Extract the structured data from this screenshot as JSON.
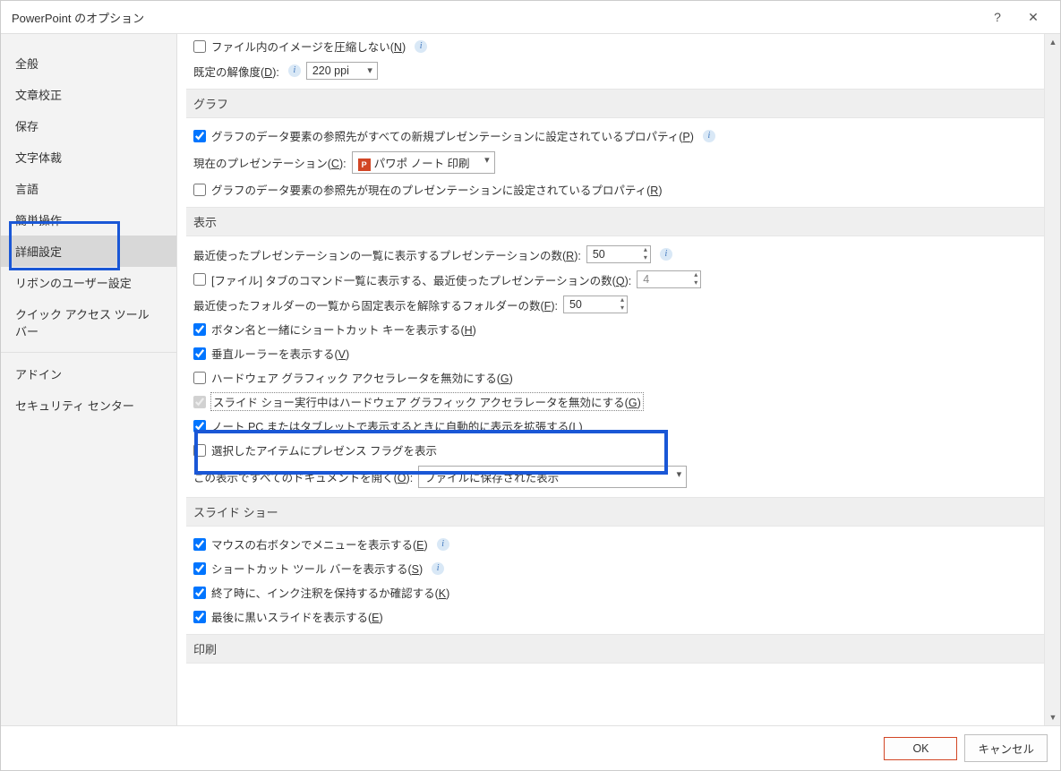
{
  "title": "PowerPoint のオプション",
  "sidebar": {
    "items": [
      {
        "label": "全般"
      },
      {
        "label": "文章校正"
      },
      {
        "label": "保存"
      },
      {
        "label": "文字体裁"
      },
      {
        "label": "言語"
      },
      {
        "label": "簡単操作"
      },
      {
        "label": "詳細設定",
        "selected": true
      },
      {
        "label": "リボンのユーザー設定"
      },
      {
        "label": "クイック アクセス ツール バー"
      },
      {
        "label": "アドイン"
      },
      {
        "label": "セキュリティ センター"
      }
    ]
  },
  "content": {
    "image_group": {
      "chk1_label": "ファイル内のイメージを圧縮しない(",
      "chk1_key": "N",
      "res_label_pre": "既定の解像度(",
      "res_key": "D",
      "res_label_post": "):",
      "res_value": "220 ppi"
    },
    "graph": {
      "title": "グラフ",
      "chk1_label": "グラフのデータ要素の参照先がすべての新規プレゼンテーションに設定されているプロパティ(",
      "chk1_key": "P",
      "pres_label_pre": "現在のプレゼンテーション(",
      "pres_key": "C",
      "pres_label_post": "):",
      "pres_value": "パワポ ノート 印刷",
      "chk2_label": "グラフのデータ要素の参照先が現在のプレゼンテーションに設定されているプロパティ(",
      "chk2_key": "R"
    },
    "display": {
      "title": "表示",
      "recent_pres_label_pre": "最近使ったプレゼンテーションの一覧に表示するプレゼンテーションの数(",
      "recent_pres_key": "R",
      "recent_pres_label_post": "):",
      "recent_pres_value": "50",
      "quick_label_pre": "[ファイル] タブのコマンド一覧に表示する、最近使ったプレゼンテーションの数(",
      "quick_key": "Q",
      "quick_label_post": "):",
      "quick_value": "4",
      "folders_label_pre": "最近使ったフォルダーの一覧から固定表示を解除するフォルダーの数(",
      "folders_key": "F",
      "folders_label_post": "):",
      "folders_value": "50",
      "chk_shortcut_label": "ボタン名と一緒にショートカット キーを表示する(",
      "chk_shortcut_key": "H",
      "chk_ruler_label": "垂直ルーラーを表示する(",
      "chk_ruler_key": "V",
      "chk_hwaccel_label": "ハードウェア グラフィック アクセラレータを無効にする(",
      "chk_hwaccel_key": "G",
      "chk_slideshow_hw_label": "スライド ショー実行中はハードウェア グラフィック アクセラレータを無効にする(",
      "chk_slideshow_hw_key": "G",
      "chk_laptop_label": "ノート PC またはタブレットで表示するときに自動的に表示を拡張する(",
      "chk_laptop_key": "L",
      "chk_presence_label": "選択したアイテムにプレゼンス フラグを表示",
      "open_docs_label_pre": "この表示ですべてのドキュメントを開く(",
      "open_docs_key": "O",
      "open_docs_label_post": "):",
      "open_docs_value": "ファイルに保存された表示"
    },
    "slideshow": {
      "title": "スライド ショー",
      "chk_rclick_label": "マウスの右ボタンでメニューを表示する(",
      "chk_rclick_key": "E",
      "chk_toolbar_label": "ショートカット ツール バーを表示する(",
      "chk_toolbar_key": "S",
      "chk_ink_label": "終了時に、インク注釈を保持するか確認する(",
      "chk_ink_key": "K",
      "chk_black_label": "最後に黒いスライドを表示する(",
      "chk_black_key": "E"
    },
    "print": {
      "title": "印刷"
    }
  },
  "footer": {
    "ok": "OK",
    "cancel": "キャンセル"
  }
}
